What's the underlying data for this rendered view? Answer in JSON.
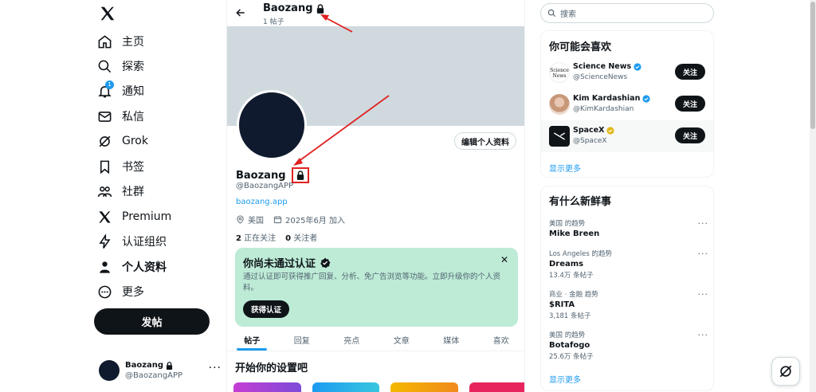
{
  "sidebar": {
    "logo": "x-logo-icon",
    "notification_count": "1",
    "items": [
      {
        "label": "主页",
        "icon": "home-icon"
      },
      {
        "label": "探索",
        "icon": "search-icon"
      },
      {
        "label": "通知",
        "icon": "bell-icon"
      },
      {
        "label": "私信",
        "icon": "mail-icon"
      },
      {
        "label": "Grok",
        "icon": "grok-icon"
      },
      {
        "label": "书签",
        "icon": "bookmark-icon"
      },
      {
        "label": "社群",
        "icon": "communities-icon"
      },
      {
        "label": "Premium",
        "icon": "x-premium-icon"
      },
      {
        "label": "认证组织",
        "icon": "lightning-icon"
      },
      {
        "label": "个人资料",
        "icon": "person-icon"
      },
      {
        "label": "更多",
        "icon": "more-circle-icon"
      }
    ],
    "post_button": "发帖",
    "account": {
      "name": "Baozang",
      "handle": "@BaozangAPP",
      "more": "···"
    }
  },
  "header": {
    "title": "Baozang",
    "post_count": "1 帖子"
  },
  "profile": {
    "edit_button": "编辑个人资料",
    "name": "Baozang",
    "handle": "@BaozangAPP",
    "link": "baozang.app",
    "location": "美国",
    "joined": "2025年6月 加入",
    "following_count": "2",
    "following_label": "正在关注",
    "followers_count": "0",
    "followers_label": "关注者"
  },
  "verify_card": {
    "title": "你尚未通过认证",
    "text": "通过认证即可获得推广回复、分析、免广告浏览等功能。立即升级你的个人资料。",
    "button": "获得认证",
    "close": "✕"
  },
  "tabs": [
    "帖子",
    "回复",
    "亮点",
    "文章",
    "媒体",
    "喜欢"
  ],
  "setup_title": "开始你的设置吧",
  "search": {
    "placeholder": "搜索"
  },
  "who_to_follow": {
    "title": "你可能会喜欢",
    "accounts": [
      {
        "name": "Science News",
        "handle": "@ScienceNews",
        "badge": "#1d9bf0",
        "follow": "关注",
        "avatar_text": "Science News"
      },
      {
        "name": "Kim Kardashian",
        "handle": "@KimKardashian",
        "badge": "#1d9bf0",
        "follow": "关注"
      },
      {
        "name": "SpaceX",
        "handle": "@SpaceX",
        "badge": "#e2b719",
        "follow": "关注"
      }
    ],
    "show_more": "显示更多"
  },
  "trends": {
    "title": "有什么新鲜事",
    "items": [
      {
        "context": "美国 的趋势",
        "title": "Mike Breen",
        "count": ""
      },
      {
        "context": "Los Angeles 的趋势",
        "title": "Dreams",
        "count": "13.4万 条帖子"
      },
      {
        "context": "商业 · 金融 趋势",
        "title": "$RITA",
        "count": "3,181 条帖子"
      },
      {
        "context": "美国 的趋势",
        "title": "Botafogo",
        "count": "25.6万 条帖子"
      }
    ],
    "show_more": "显示更多"
  },
  "colors": {
    "accent": "#1d9bf0",
    "verify_bg": "#bdebd6",
    "annotation": "#e02020"
  }
}
